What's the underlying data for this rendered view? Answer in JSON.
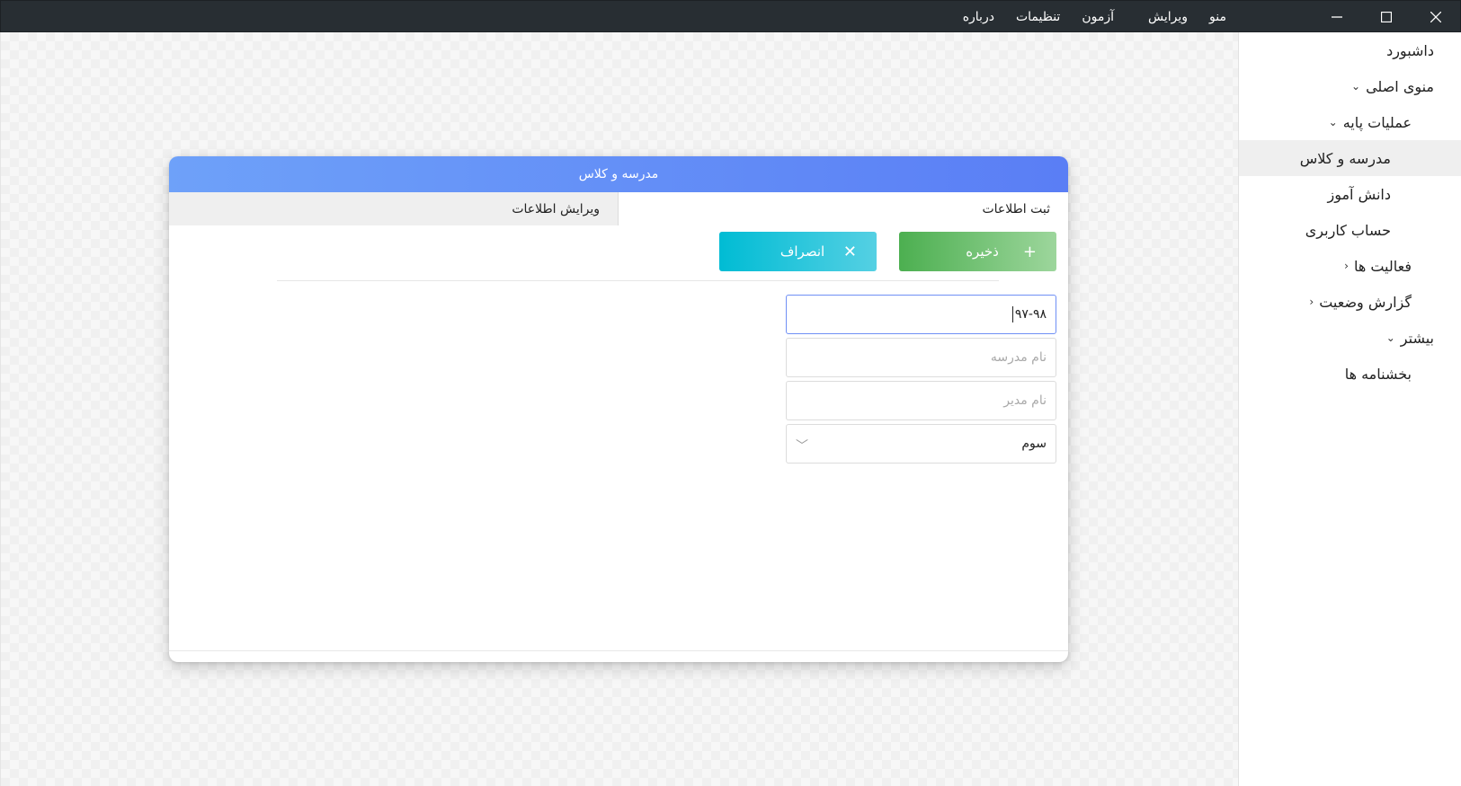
{
  "titlebar": {
    "menu": [
      {
        "label": "منو"
      },
      {
        "label": "ویرایش"
      },
      {
        "label": "آزمون"
      },
      {
        "label": "تنظیمات"
      },
      {
        "label": "درباره"
      }
    ]
  },
  "sidebar": {
    "items": [
      {
        "label": "داشبورد"
      },
      {
        "label": "منوی اصلی"
      },
      {
        "label": "عملیات پایه"
      },
      {
        "label": "مدرسه و کلاس"
      },
      {
        "label": "دانش آموز"
      },
      {
        "label": "حساب کاربری"
      },
      {
        "label": "فعالیت ها"
      },
      {
        "label": "گزارش وضعیت"
      },
      {
        "label": "بیشتر"
      },
      {
        "label": "بخشنامه ها"
      }
    ]
  },
  "dialog": {
    "title": "مدرسه و کلاس",
    "tabs": [
      {
        "label": "ثبت اطلاعات"
      },
      {
        "label": "ویرایش اطلاعات"
      }
    ],
    "save_label": "ذخیره",
    "cancel_label": "انصراف",
    "fields": {
      "year_value": "۹۷-۹۸",
      "school_name_placeholder": "نام مدرسه",
      "manager_name_placeholder": "نام مدیر",
      "grade_selected": "سوم"
    }
  },
  "colors": {
    "titlebar": "#282e33",
    "header_gradient_start": "#6ea1f9",
    "header_gradient_end": "#5a7ef5",
    "save_button": "#4caf50",
    "cancel_button": "#00bcd4",
    "active_sidebar": "#efefef"
  },
  "icons": {
    "minimize": "minimize-icon",
    "maximize": "maximize-icon",
    "close": "close-icon",
    "plus": "plus-icon",
    "x": "x-icon",
    "chevron_down": "chevron-down-icon",
    "chevron_left": "chevron-left-icon"
  }
}
